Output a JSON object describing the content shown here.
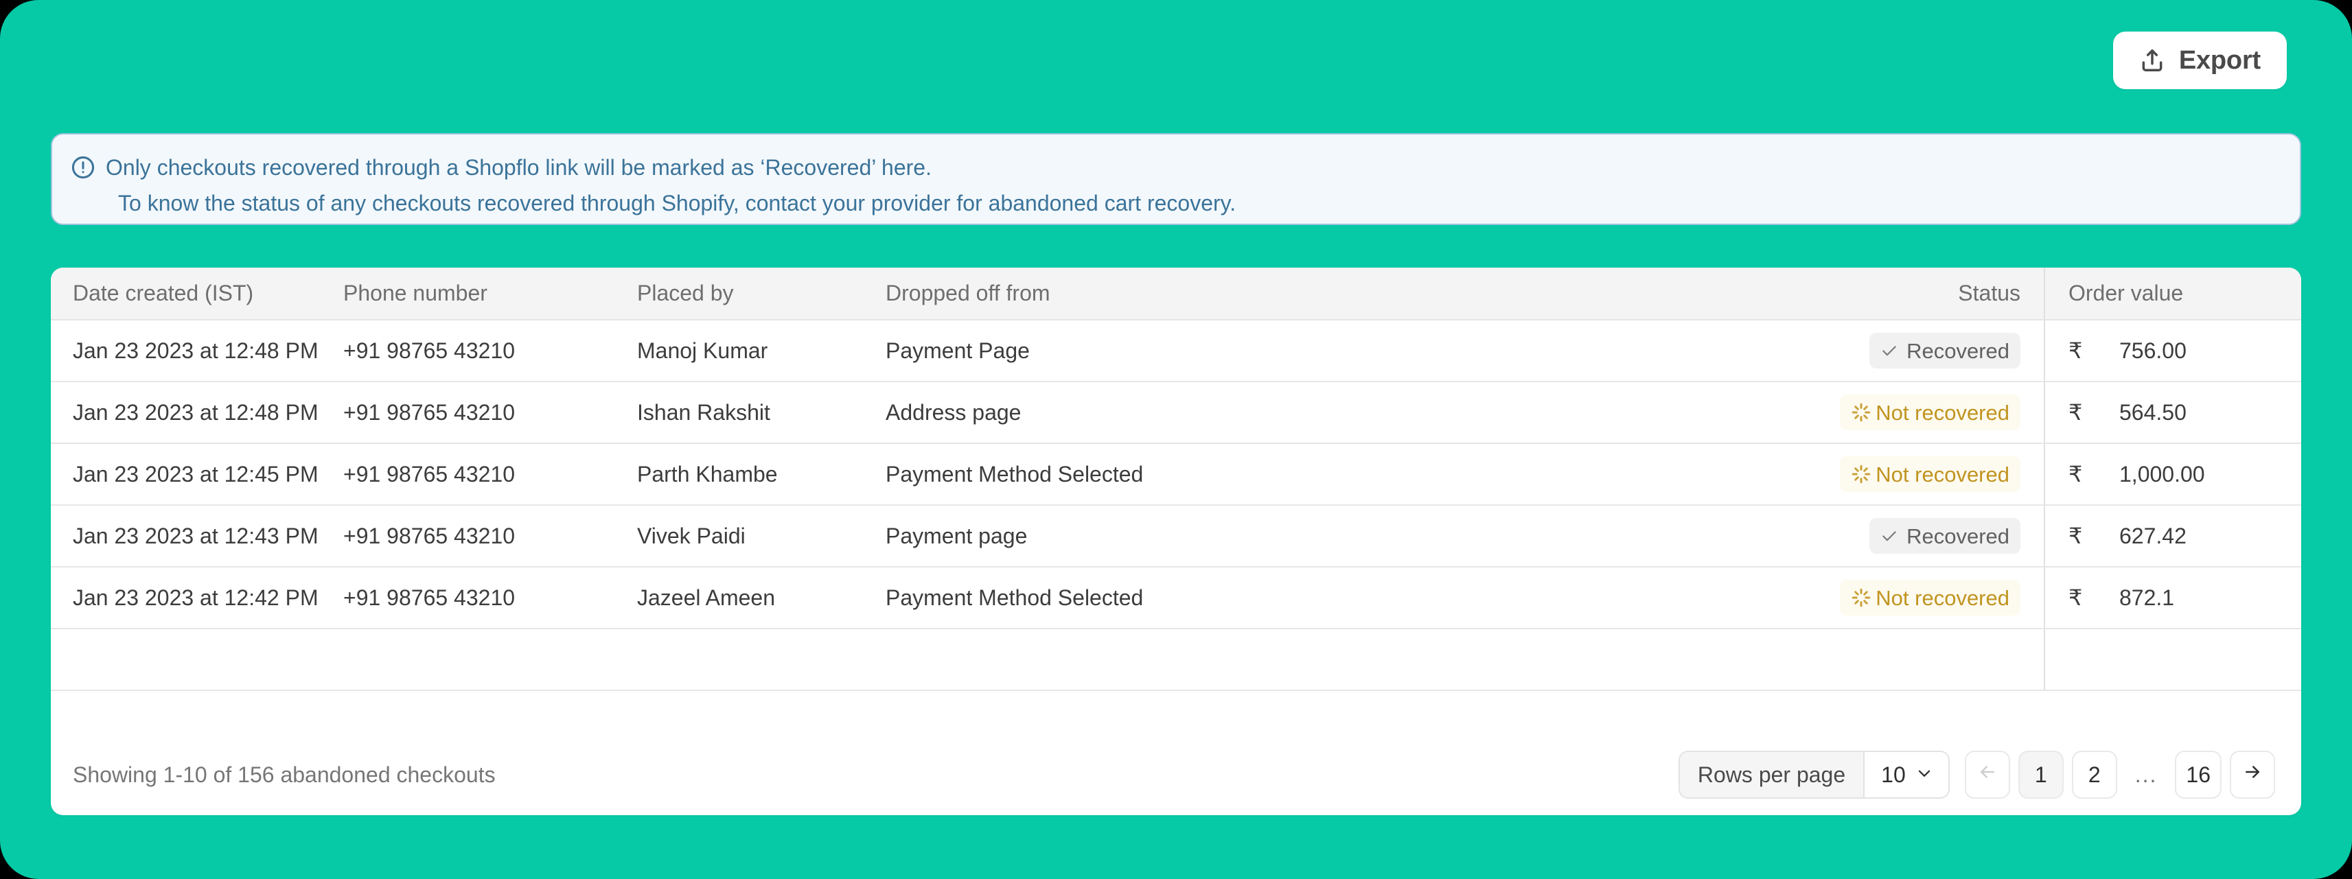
{
  "theme": {
    "background": "#06C9A6",
    "card_background": "#FFFFFF",
    "alert_background": "#F3F8FC",
    "alert_border": "#9DC3DC",
    "alert_text": "#3B7399",
    "badge_recovered_bg": "#F1F1F1",
    "badge_recovered_text": "#616161",
    "badge_not_recovered_bg": "#FDFAEF",
    "badge_not_recovered_text": "#C09420"
  },
  "toolbar": {
    "export_label": "Export",
    "export_icon": "upload-share-icon"
  },
  "alert": {
    "icon": "exclamation-circle-icon",
    "line1": "Only checkouts recovered through a Shopflo link will be marked as ‘Recovered’ here.",
    "line2": "To know the status of any checkouts recovered through Shopify, contact your provider for abandoned cart recovery."
  },
  "table": {
    "columns": [
      {
        "key": "date",
        "label": "Date created (IST)"
      },
      {
        "key": "phone",
        "label": "Phone number"
      },
      {
        "key": "placed",
        "label": "Placed by"
      },
      {
        "key": "dropped",
        "label": "Dropped off from"
      },
      {
        "key": "status",
        "label": "Status"
      },
      {
        "key": "value",
        "label": "Order value"
      }
    ],
    "rows": [
      {
        "date": "Jan 23 2023 at 12:48 PM",
        "phone": "+91 98765 43210",
        "placed": "Manoj Kumar",
        "dropped": "Payment Page",
        "status": "Recovered",
        "status_type": "recovered",
        "status_icon": "check-icon",
        "currency": "₹",
        "amount": "756.00"
      },
      {
        "date": "Jan 23 2023 at 12:48 PM",
        "phone": "+91 98765 43210",
        "placed": "Ishan Rakshit",
        "dropped": "Address page",
        "status": "Not recovered",
        "status_type": "not-recovered",
        "status_icon": "spinner-burst-icon",
        "currency": "₹",
        "amount": "564.50"
      },
      {
        "date": "Jan 23 2023 at 12:45 PM",
        "phone": "+91 98765 43210",
        "placed": "Parth Khambe",
        "dropped": "Payment Method Selected",
        "status": "Not recovered",
        "status_type": "not-recovered",
        "status_icon": "spinner-burst-icon",
        "currency": "₹",
        "amount": "1,000.00"
      },
      {
        "date": "Jan 23 2023 at 12:43 PM",
        "phone": "+91 98765 43210",
        "placed": "Vivek Paidi",
        "dropped": "Payment page",
        "status": "Recovered",
        "status_type": "recovered",
        "status_icon": "check-icon",
        "currency": "₹",
        "amount": "627.42"
      },
      {
        "date": "Jan 23 2023 at 12:42 PM",
        "phone": "+91 98765 43210",
        "placed": "Jazeel Ameen",
        "dropped": "Payment Method Selected",
        "status": "Not recovered",
        "status_type": "not-recovered",
        "status_icon": "spinner-burst-icon",
        "currency": "₹",
        "amount": "872.1"
      }
    ]
  },
  "footer": {
    "showing": "Showing 1-10 of 156 abandoned checkouts",
    "rows_per_page_label": "Rows per page",
    "rows_per_page_value": "10",
    "rows_per_page_chevron": "chevron-down-icon",
    "prev_icon": "arrow-left-icon",
    "next_icon": "arrow-right-icon",
    "pages": [
      "1",
      "2",
      "...",
      "16"
    ],
    "active_page": "1"
  }
}
